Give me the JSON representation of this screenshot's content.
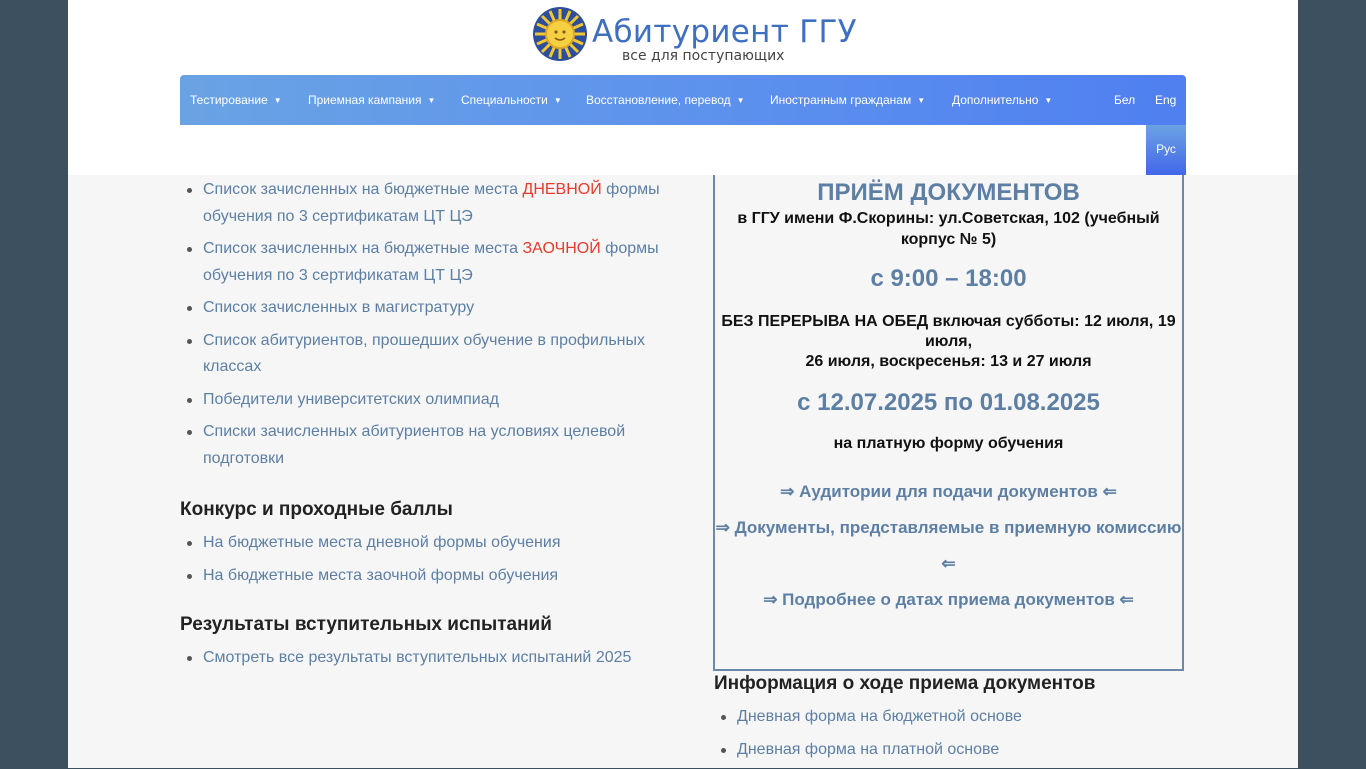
{
  "logo": {
    "title": "Абитуриент ГГУ",
    "subtitle": "все для поступающих",
    "icon": "sun-logo-icon"
  },
  "nav": {
    "items": [
      {
        "label": "Тестирование"
      },
      {
        "label": "Приемная кампания"
      },
      {
        "label": "Специальности"
      },
      {
        "label": "Восстановление, перевод"
      },
      {
        "label": "Иностранным гражданам"
      },
      {
        "label": "Дополнительно"
      }
    ],
    "lang": {
      "be": "Бел",
      "en": "Eng",
      "ru": "Рус"
    },
    "caret": "▼"
  },
  "lists": {
    "budget_day_pre": "Список зачисленных на бюджетные места ",
    "budget_day_red": "ДНЕВНОЙ",
    "budget_day_post": " формы обучения по 3 сертификатам ЦТ ЦЭ",
    "budget_ext_pre": "Список зачисленных на бюджетные места ",
    "budget_ext_red": "ЗАОЧНОЙ",
    "budget_ext_post": " формы обучения по 3 сертификатам ЦТ ЦЭ",
    "magistracy": "Список зачисленных в магистратуру",
    "profile": "Список абитуриентов, прошедших обучение в профильных классах",
    "olympiad": "Победители университетских олимпиад",
    "target": "Списки зачисленных абитуриентов на условиях целевой подготовки"
  },
  "contest": {
    "heading": "Конкурс и проходные баллы",
    "items": [
      "На бюджетные места дневной формы обучения",
      "На бюджетные места заочной формы обучения"
    ]
  },
  "results": {
    "heading": "Результаты вступительных испытаний",
    "items": [
      "Смотреть все результаты вступительных испытаний 2025"
    ]
  },
  "box": {
    "title": "ПРИЁМ ДОКУМЕНТОВ",
    "address": "в ГГУ имени Ф.Скорины: ул.Советская, 102 (учебный корпус № 5)",
    "time": "с 9:00 – 18:00",
    "break_line1": "БЕЗ ПЕРЕРЫВА НА ОБЕД включая субботы: 12 июля, 19 июля,",
    "break_line2": "26 июля, воскресенья: 13 и 27 июля",
    "dates": "с 12.07.2025 по 01.08.2025",
    "paid": "на платную форму обучения",
    "links": [
      "⇒ Аудитории для подачи документов ⇐",
      "⇒ Документы, представляемые в приемную комиссию ⇐",
      "⇒ Подробнее о датах приема документов ⇐"
    ]
  },
  "info": {
    "heading": "Информация о ходе приема документов",
    "items": [
      "Дневная форма на бюджетной основе",
      "Дневная форма на платной основе"
    ]
  }
}
